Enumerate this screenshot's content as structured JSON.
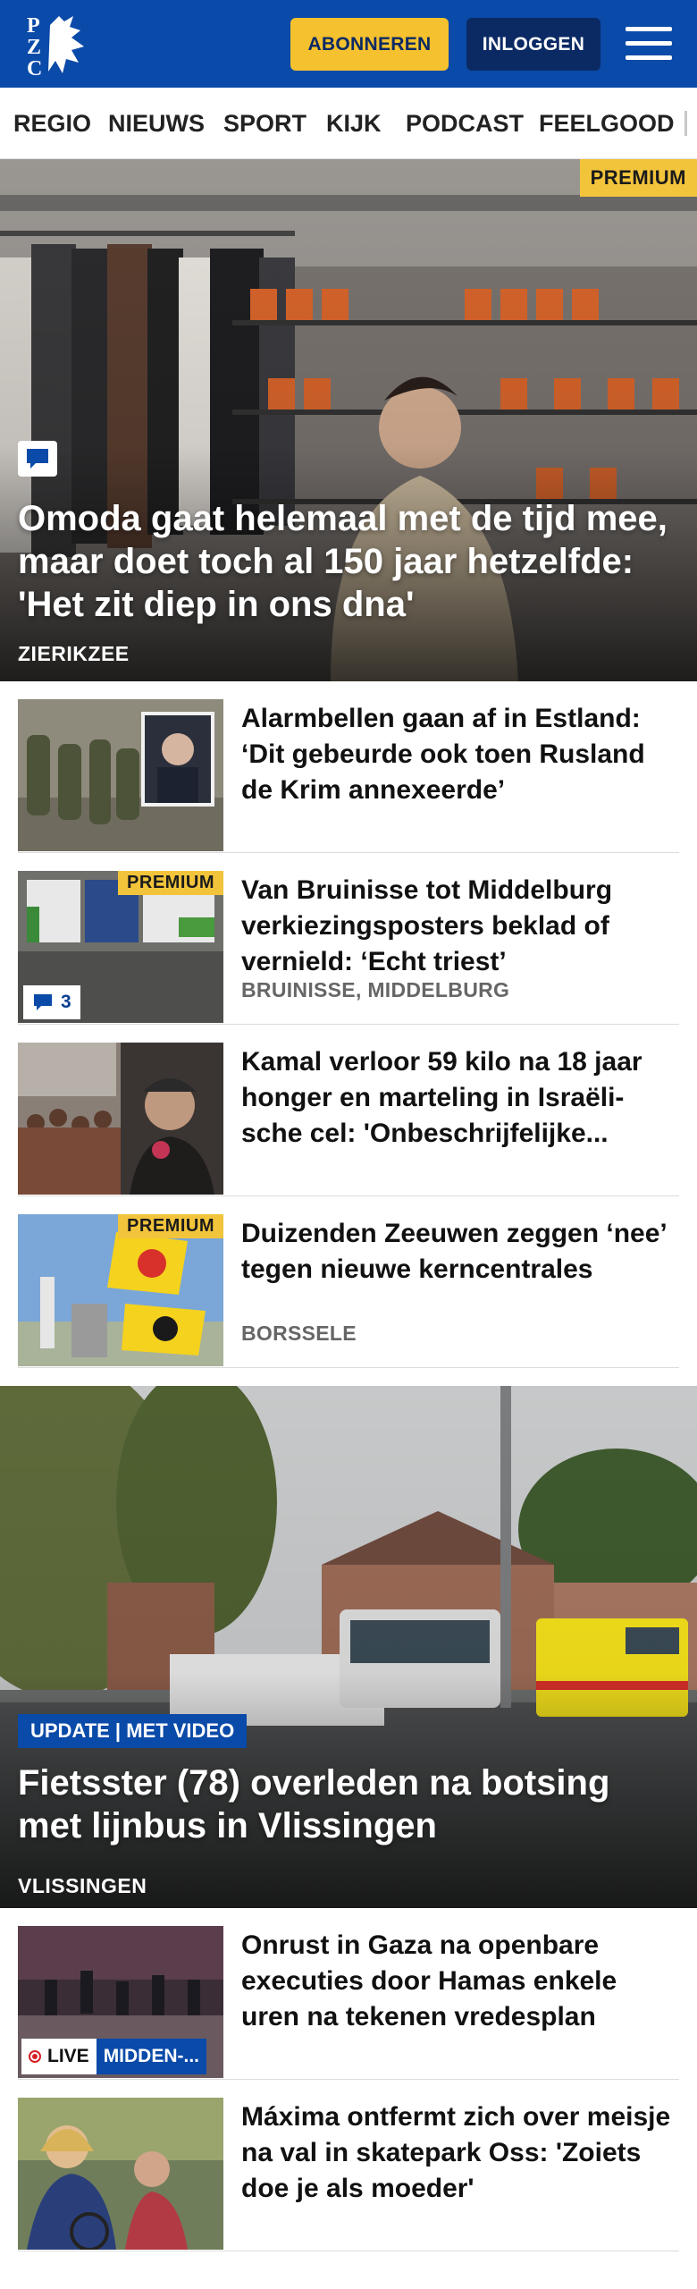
{
  "header": {
    "logo_text": "PZC",
    "subscribe_label": "ABONNEREN",
    "login_label": "INLOGGEN",
    "brand_color": "#0a4aa8",
    "accent_color": "#f5c12e",
    "menu_icon": "hamburger-menu-icon"
  },
  "nav": {
    "items": [
      {
        "label": "REGIO"
      },
      {
        "label": "NIEUWS"
      },
      {
        "label": "SPORT"
      },
      {
        "label": "KIJK"
      },
      {
        "label": "PODCAST"
      },
      {
        "label": "FEELGOOD"
      }
    ]
  },
  "hero": {
    "badge": "PREMIUM",
    "comment_icon": "comment-bubble-icon",
    "title": "Omoda gaat helemaal met de tijd mee, maar doet toch al 150 jaar hetzelfde: 'Het zit diep in ons dna'",
    "location": "ZIERIKZEE"
  },
  "articles_1": [
    {
      "title": "Alarmbellen gaan af in Estland: ‘Dit gebeurde ook toen Rusland de Krim annexeerde’",
      "location": "",
      "premium": false
    },
    {
      "title": "Van Bruinisse tot Middelburg verkiezingsposters beklad of vernield: ‘Echt triest’",
      "location": "BRUINISSE, MIDDELBURG",
      "premium": true,
      "badge": "PREMIUM",
      "comments": "3"
    },
    {
      "title": "Kamal verloor 59 kilo na 18 jaar honger en marteling in Israëli-sche cel: 'Onbeschrijfelijke...",
      "location": "",
      "premium": false
    },
    {
      "title": "Duizenden Zeeuwen zeggen ‘nee’ tegen nieuwe kerncentrales",
      "location": "BORSSELE",
      "premium": true,
      "badge": "PREMIUM"
    }
  ],
  "hero2": {
    "badge": "UPDATE | MET VIDEO",
    "title": "Fietsster (78) overleden na botsing met lijnbus in Vlissingen",
    "location": "VLISSINGEN"
  },
  "articles_2": [
    {
      "title": "Onrust in Gaza na openbare executies door Hamas enkele uren na tekenen vredesplan",
      "live_label": "LIVE",
      "category": "MIDDEN-..."
    },
    {
      "title": "Máxima ontfermt zich over meisje na val in skatepark Oss: 'Zoiets doe je als moeder'"
    }
  ]
}
